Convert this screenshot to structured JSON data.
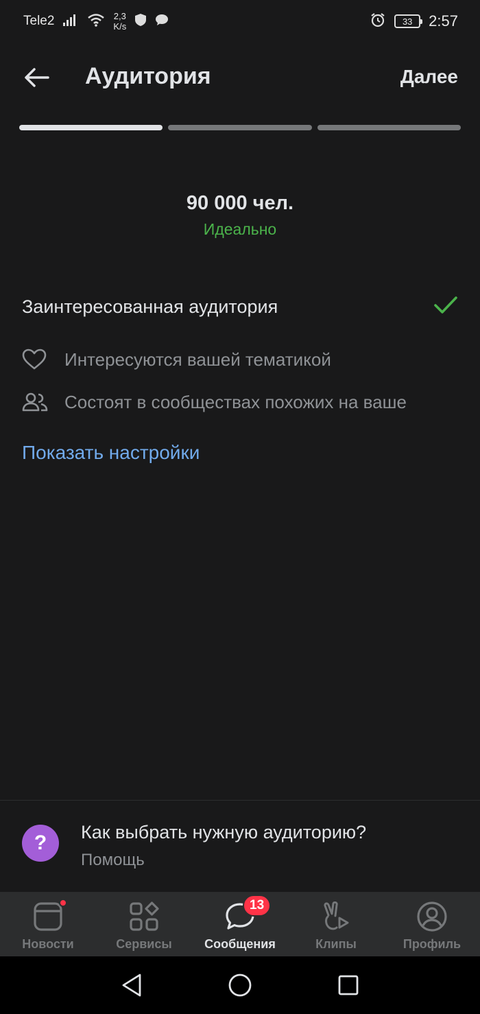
{
  "status_bar": {
    "carrier": "Tele2",
    "speed_value": "2,3",
    "speed_unit": "K/s",
    "battery": "33",
    "time": "2:57"
  },
  "header": {
    "title": "Аудитория",
    "next_label": "Далее"
  },
  "steps": {
    "total": 3,
    "current": 1
  },
  "summary": {
    "size": "90 000 чел.",
    "quality": "Идеально"
  },
  "audience_type": {
    "label": "Заинтересованная аудитория",
    "selected": true
  },
  "criteria": [
    {
      "icon": "heart-icon",
      "label": "Интересуются вашей тематикой"
    },
    {
      "icon": "users-icon",
      "label": "Состоят в сообществах похожих на ваше"
    }
  ],
  "show_settings_label": "Показать настройки",
  "help": {
    "badge": "?",
    "title": "Как выбрать нужную аудиторию?",
    "subtitle": "Помощь"
  },
  "tabbar": {
    "items": [
      {
        "label": "Новости",
        "icon": "news-icon",
        "active": false
      },
      {
        "label": "Сервисы",
        "icon": "services-icon",
        "active": false
      },
      {
        "label": "Сообщения",
        "icon": "messages-icon",
        "active": true,
        "badge": "13"
      },
      {
        "label": "Клипы",
        "icon": "clips-icon",
        "active": false
      },
      {
        "label": "Профиль",
        "icon": "profile-icon",
        "active": false
      }
    ]
  },
  "colors": {
    "background": "#19191a",
    "accent_link": "#71aaeb",
    "success": "#4bb34b",
    "badge": "#ff3347",
    "help_badge": "#a35ed8"
  }
}
